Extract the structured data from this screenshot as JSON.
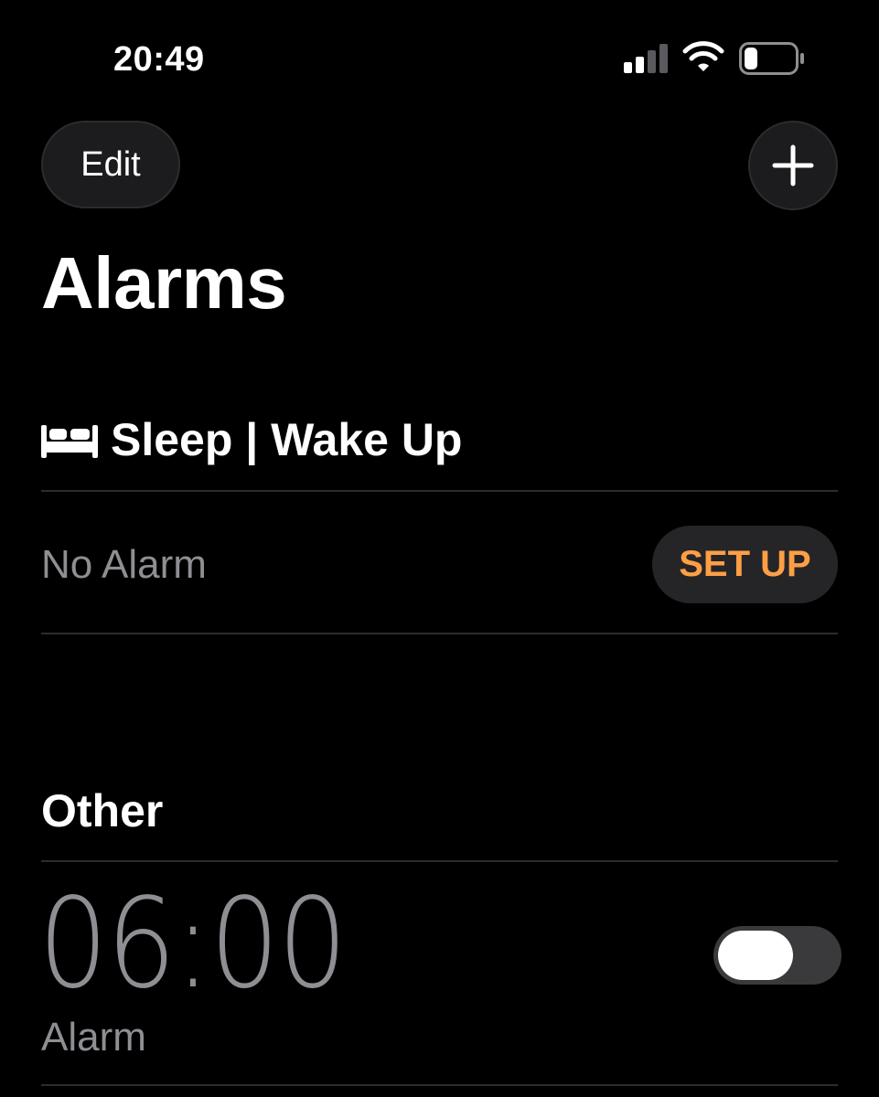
{
  "status_bar": {
    "time": "20:49",
    "icons": [
      "cellular-signal-icon",
      "wifi-icon",
      "battery-icon"
    ]
  },
  "header": {
    "edit_label": "Edit",
    "add_icon": "plus-icon",
    "title": "Alarms"
  },
  "sleep_section": {
    "icon": "bed-icon",
    "title": "Sleep | Wake Up",
    "status": "No Alarm",
    "setup_label": "SET UP"
  },
  "other_section": {
    "title": "Other",
    "alarms": [
      {
        "time": "06:00",
        "label": "Alarm",
        "enabled": false
      }
    ]
  },
  "colors": {
    "background": "#000000",
    "accent": "#ff9f45",
    "secondary_text": "#8e8e93",
    "button_bg": "#1c1c1e",
    "divider": "#2c2c2e"
  }
}
